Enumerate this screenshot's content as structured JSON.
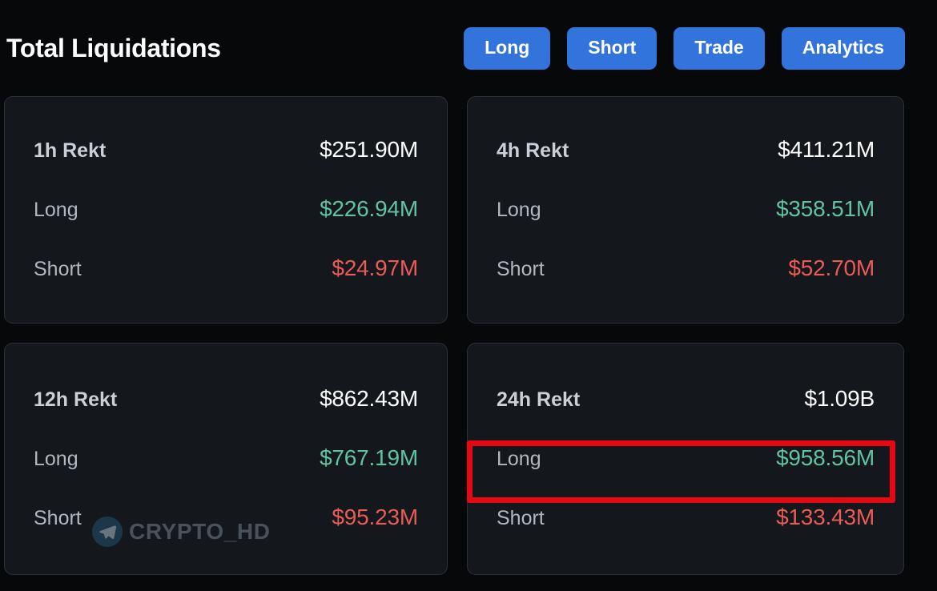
{
  "header": {
    "title": "Total Liquidations",
    "nav_buttons": [
      {
        "label": "Long",
        "name": "nav-button-long"
      },
      {
        "label": "Short",
        "name": "nav-button-short"
      },
      {
        "label": "Trade",
        "name": "nav-button-trade"
      },
      {
        "label": "Analytics",
        "name": "nav-button-analytics"
      }
    ]
  },
  "colors": {
    "page_background": "#07080a",
    "card_background": "#14181d",
    "card_border": "#2b3038",
    "accent_blue": "#3373dc",
    "long_green": "#62c3a0",
    "short_red": "#ea5b55",
    "total_white": "#ffffff",
    "label_gray": "#b2b8c0",
    "highlight_red": "#e50914",
    "watermark_gray": "#4b5159"
  },
  "cards": [
    {
      "id": "card-1h",
      "total_label": "1h Rekt",
      "total_value": "$251.90M",
      "long_label": "Long",
      "long_value": "$226.94M",
      "short_label": "Short",
      "short_value": "$24.97M"
    },
    {
      "id": "card-4h",
      "total_label": "4h Rekt",
      "total_value": "$411.21M",
      "long_label": "Long",
      "long_value": "$358.51M",
      "short_label": "Short",
      "short_value": "$52.70M"
    },
    {
      "id": "card-12h",
      "total_label": "12h Rekt",
      "total_value": "$862.43M",
      "long_label": "Long",
      "long_value": "$767.19M",
      "short_label": "Short",
      "short_value": "$95.23M"
    },
    {
      "id": "card-24h",
      "total_label": "24h Rekt",
      "total_value": "$1.09B",
      "long_label": "Long",
      "long_value": "$958.56M",
      "short_label": "Short",
      "short_value": "$133.43M"
    }
  ],
  "annotation": {
    "target": "24h Rekt Long row",
    "highlighted_value": "$958.56M",
    "box_color": "#e50914"
  },
  "watermark": {
    "text": "CRYPTO_HD",
    "icon": "telegram-icon"
  }
}
